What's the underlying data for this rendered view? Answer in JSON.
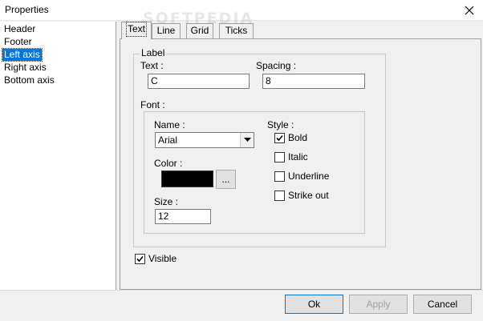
{
  "window": {
    "title": "Properties",
    "watermark": "SOFTPEDIA"
  },
  "sidebar": {
    "items": [
      {
        "label": "Header"
      },
      {
        "label": "Footer"
      },
      {
        "label": "Left axis"
      },
      {
        "label": "Right axis"
      },
      {
        "label": "Bottom axis"
      }
    ],
    "selected": "Left axis"
  },
  "tabs": [
    {
      "label": "Text"
    },
    {
      "label": "Line"
    },
    {
      "label": "Grid"
    },
    {
      "label": "Ticks"
    }
  ],
  "active_tab": "Text",
  "label_group": {
    "title": "Label",
    "text_label": "Text :",
    "text_value": "C",
    "spacing_label": "Spacing :",
    "spacing_value": "8"
  },
  "font_group": {
    "title": "Font :",
    "name_label": "Name :",
    "name_value": "Arial",
    "color_label": "Color :",
    "color_value": "#000000",
    "color_button": "...",
    "size_label": "Size :",
    "size_value": "12",
    "style_label": "Style :",
    "styles": [
      {
        "label": "Bold",
        "checked": true
      },
      {
        "label": "Italic",
        "checked": false
      },
      {
        "label": "Underline",
        "checked": false
      },
      {
        "label": "Strike out",
        "checked": false
      }
    ]
  },
  "visible": {
    "label": "Visible",
    "checked": true
  },
  "buttons": {
    "ok": "Ok",
    "apply": "Apply",
    "cancel": "Cancel"
  },
  "icons": {
    "close": "close-icon",
    "dropdown": "chevron-down-icon",
    "check": "check-icon"
  }
}
